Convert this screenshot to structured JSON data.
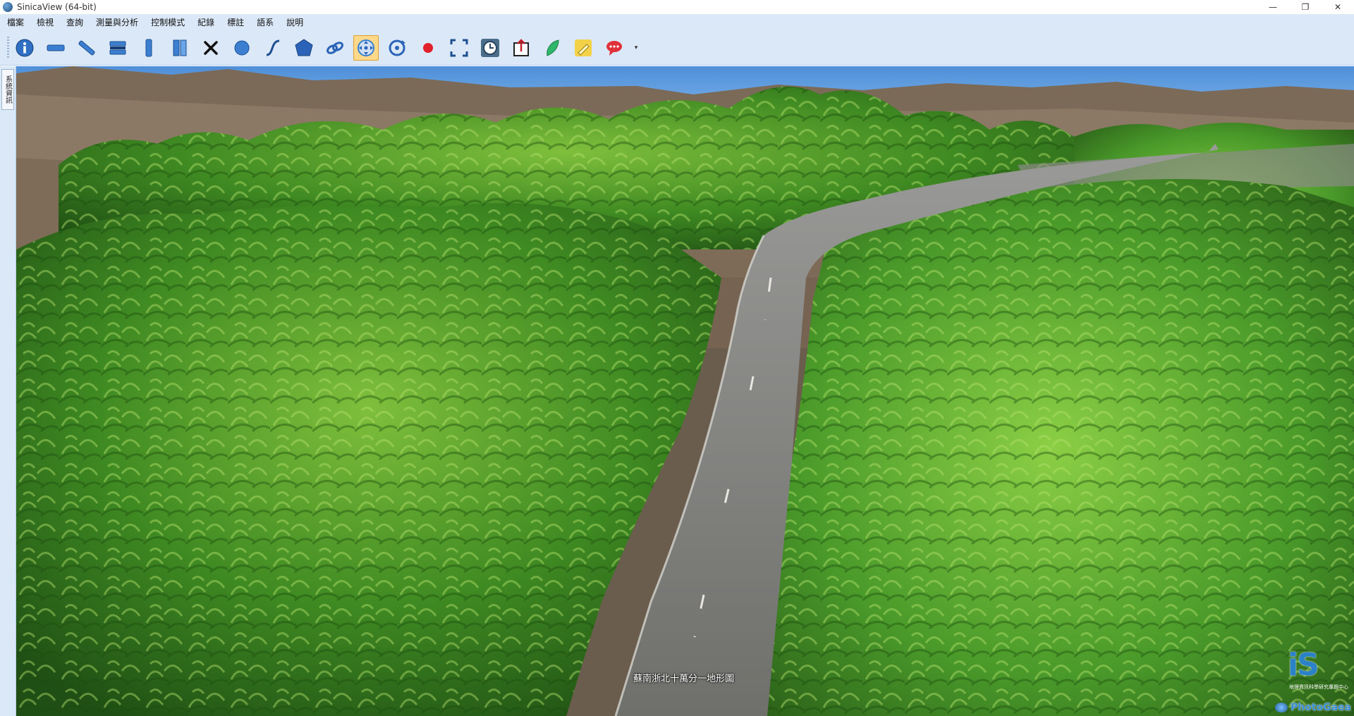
{
  "window": {
    "title": "SinicaView (64-bit)",
    "controls": {
      "minimize": "—",
      "restore": "❐",
      "close": "✕"
    }
  },
  "menu": [
    "檔案",
    "檢視",
    "查詢",
    "測量與分析",
    "控制模式",
    "紀錄",
    "標註",
    "語系",
    "說明"
  ],
  "toolbar": {
    "tools": [
      {
        "icon": "info-icon",
        "active": false
      },
      {
        "icon": "horizontal-distance-icon",
        "active": false
      },
      {
        "icon": "diagonal-distance-icon",
        "active": false
      },
      {
        "icon": "layer-stack-icon",
        "active": false
      },
      {
        "icon": "vertical-distance-icon",
        "active": false
      },
      {
        "icon": "vertical-profile-icon",
        "active": false
      },
      {
        "icon": "clear-icon",
        "active": false
      },
      {
        "icon": "circle-area-icon",
        "active": false
      },
      {
        "icon": "curve-icon",
        "active": false
      },
      {
        "icon": "polygon-area-icon",
        "active": false
      },
      {
        "icon": "link-icon",
        "active": false
      },
      {
        "icon": "pan-control-icon",
        "active": true
      },
      {
        "icon": "rotate-icon",
        "active": false
      },
      {
        "icon": "record-icon",
        "active": false
      },
      {
        "icon": "full-extent-icon",
        "active": false
      },
      {
        "icon": "history-clock-icon",
        "active": false
      },
      {
        "icon": "export-icon",
        "active": false
      },
      {
        "icon": "feather-icon",
        "active": false
      },
      {
        "icon": "marker-icon",
        "active": false
      },
      {
        "icon": "comment-icon",
        "active": false
      }
    ]
  },
  "side_panel": {
    "tab_label": "系統資訊"
  },
  "viewport": {
    "map_caption": "蘇南浙北十萬分一地形圖",
    "logo_text": "iS",
    "logo_subtitle": "地理資訊科學研究專題中心",
    "logo2_text": "PhotoGaea"
  }
}
